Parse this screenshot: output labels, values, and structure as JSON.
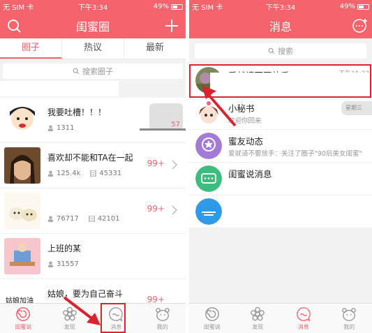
{
  "left": {
    "status": {
      "carrier": "无 SIM 卡",
      "time": "下午3:34",
      "battery": "49%"
    },
    "title": "闺蜜圈",
    "tabs": [
      "圈子",
      "热议",
      "最新"
    ],
    "search_placeholder": "搜索圈子",
    "groups": [
      {
        "name": "我要吐槽！！！",
        "members": "1311",
        "posts": "",
        "badge": "",
        "preview_badge": "57"
      },
      {
        "name": "喜欢却不能和TA在一起",
        "members": "125.4k",
        "posts": "45331",
        "badge": "99+",
        "preview_badge": ""
      },
      {
        "name": "",
        "members": "76717",
        "posts": "42101",
        "badge": "99+",
        "preview_badge": ""
      },
      {
        "name": "上班的某",
        "members": "31557",
        "posts": "",
        "badge": "",
        "preview_badge": ""
      },
      {
        "name": "姑娘，要为自己奋斗",
        "members": "",
        "posts": "",
        "badge": "99+",
        "preview_badge": ""
      }
    ],
    "avatar_texts": {
      "brush": "姑娘加油"
    },
    "tabbar": [
      {
        "label": "闺蜜说",
        "icon": "swirl-icon",
        "active": true
      },
      {
        "label": "发现",
        "icon": "flower-icon",
        "active": false
      },
      {
        "label": "消息",
        "icon": "message-icon",
        "active": false
      },
      {
        "label": "我的",
        "icon": "bear-icon",
        "active": false
      }
    ]
  },
  "right": {
    "status": {
      "carrier": "无 SIM 卡",
      "time": "下午3:34",
      "battery": "49%"
    },
    "title": "消息",
    "search_placeholder": "搜索",
    "messages": [
      {
        "name": "爱就请不要放手",
        "preview": "",
        "time": "下午15:33"
      },
      {
        "name": "小秘书",
        "preview": "欢迎你回来",
        "time": ""
      },
      {
        "name": "蜜友动态",
        "preview": "爱就请不要放手：关注了圈子\"90后美女闺蜜\"",
        "time": ""
      },
      {
        "name": "闺蜜说消息",
        "preview": "",
        "time": ""
      },
      {
        "name": "",
        "preview": "",
        "time": ""
      }
    ],
    "side_snippet": "星期三",
    "tabbar": [
      {
        "label": "闺蜜说",
        "icon": "swirl-icon",
        "active": false
      },
      {
        "label": "发现",
        "icon": "flower-icon",
        "active": false
      },
      {
        "label": "消息",
        "icon": "message-icon",
        "active": true
      },
      {
        "label": "我的",
        "icon": "bear-icon",
        "active": false
      }
    ]
  },
  "colors": {
    "brand": "#f5636c",
    "annotation": "#d9232d",
    "purple": "#a37ad6",
    "green": "#3dbd7d",
    "blue": "#2f9be8"
  }
}
